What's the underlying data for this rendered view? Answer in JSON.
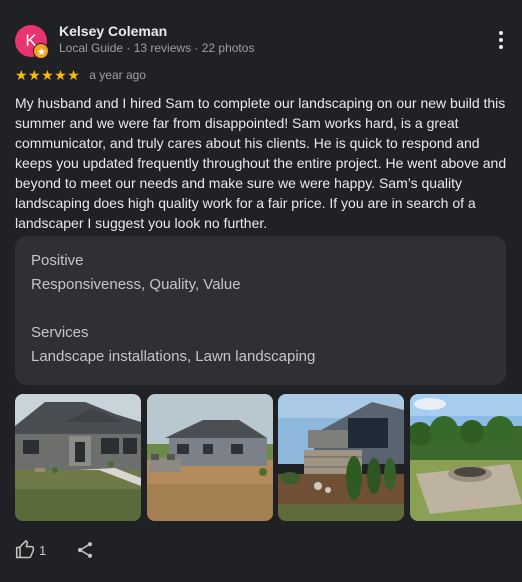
{
  "reviewer": {
    "initial": "K",
    "avatar_color": "#e8356f",
    "badge_color": "#f4a51c",
    "badge_icon": "star-icon",
    "name": "Kelsey Coleman",
    "meta": "Local Guide · 13 reviews · 22 photos"
  },
  "menu_icon": "more-vert-icon",
  "rating": {
    "stars": 5,
    "stars_text": "★★★★★",
    "star_color": "#fbbc04",
    "time": "a year ago"
  },
  "review": {
    "text": "My husband and I hired Sam to complete our landscaping on our new build this summer and we were far from disappointed! Sam works hard, is a great communicator, and truly cares about his clients. He is quick to respond and keeps you updated frequently throughout the entire project. He went above and beyond to meet our needs and make sure we were happy. Sam’s quality landscaping does high quality work for a fair price. If you are in search of a landscaper I suggest you look no further."
  },
  "attributes": [
    {
      "label": "Positive",
      "value": "Responsiveness, Quality, Value"
    },
    {
      "label": "Services",
      "value": "Landscape installations, Lawn landscaping"
    }
  ],
  "photos": [
    {
      "subject": "house-front-with-lawn"
    },
    {
      "subject": "house-backyard-with-dirt"
    },
    {
      "subject": "stone-wall-with-shrubs"
    },
    {
      "subject": "fire-pit-patio"
    }
  ],
  "actions": {
    "like_icon": "thumb-up-icon",
    "like_count": "1",
    "share_icon": "share-icon"
  }
}
